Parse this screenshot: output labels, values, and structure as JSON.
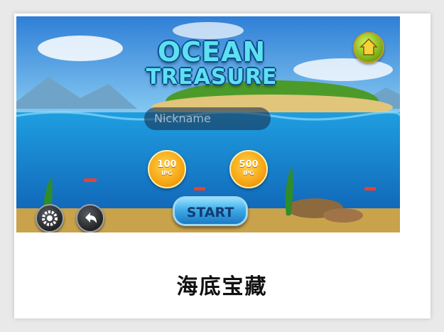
{
  "game": {
    "title_line1": "OCEAN",
    "title_line2": "TREASURE",
    "nickname_placeholder": "Nickname",
    "coins": [
      {
        "amount": "100",
        "currency": "IPG"
      },
      {
        "amount": "500",
        "currency": "IPG"
      }
    ],
    "start_label": "START",
    "icons": {
      "home": "home-icon",
      "settings": "gear-icon",
      "back": "back-arrow-icon"
    }
  },
  "caption": "海底宝藏",
  "colors": {
    "sea": "#2a8fd4",
    "start_button": "#3aa6e4",
    "coin": "#f7a514",
    "home_button": "#7eb51a"
  }
}
